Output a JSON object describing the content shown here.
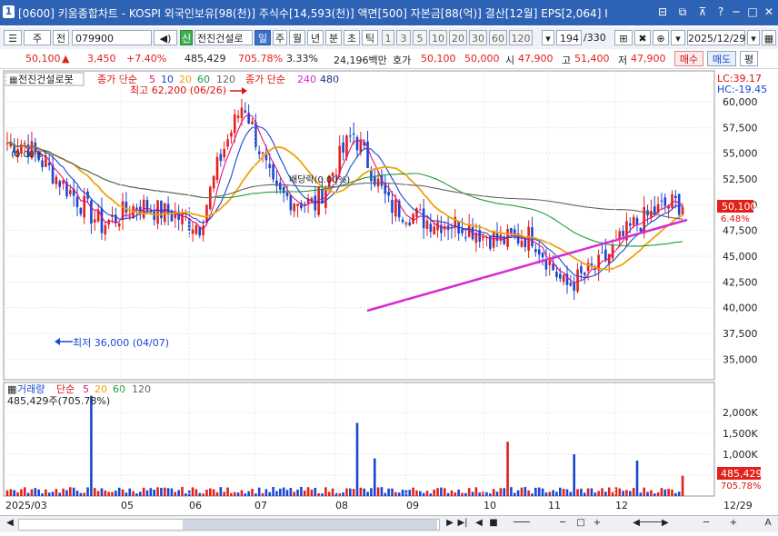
{
  "titlebar": {
    "window_number": "1",
    "title": "[0600] 키움종합차트 - KOSPI 외국인보유[98(천)] 주식수[14,593(천)] 액면[500] 자본금[88(억)] 결산[12월] EPS[2,064] I",
    "buttons": [
      "⊟",
      "⧉",
      "⊼",
      "?",
      "─",
      "□",
      "✕"
    ]
  },
  "toolbar": {
    "market": "주",
    "period_type": "전",
    "code": "079900",
    "credit_badge": "신",
    "stock_name": "전진건설로",
    "timeframes": [
      "일",
      "주",
      "월",
      "년",
      "분",
      "초",
      "틱"
    ],
    "selected_timeframe": "일",
    "ticks": [
      "1",
      "3",
      "5",
      "10",
      "20",
      "30",
      "60",
      "120"
    ],
    "count": "194",
    "total": "/330",
    "date": "2025/12/29"
  },
  "infobar": {
    "price": "50,100",
    "arrow": "▲",
    "change": "3,450",
    "pct": "+7.40%",
    "volume": "485,429",
    "vol_ratio": "705.78%",
    "turnover": "3.33%",
    "amount": "24,196백만",
    "quote_label": "호가",
    "bid": "50,100",
    "ask": "50,000",
    "open_label": "시",
    "open": "47,900",
    "high_label": "고",
    "high": "51,400",
    "low_label": "저",
    "low": "47,900",
    "buy": "매수",
    "sell": "매도",
    "eval": "평"
  },
  "price_panel": {
    "name": "전진건설로봇",
    "ma_label": "종가 단순",
    "ma_periods": [
      "5",
      "10",
      "20",
      "60",
      "120"
    ],
    "ma_colors": [
      "#e0117f",
      "#1a46d2",
      "#f0a20a",
      "#1f9b3a",
      "#666666"
    ],
    "ma2_label": "종가 단순",
    "ma2_periods": [
      "240",
      "480"
    ],
    "high_label": "최고 62,200 (06/26)",
    "low_label": "최저 36,000 (04/07)",
    "marker1": "(0.00%)",
    "marker2": "배당락(0.00%)",
    "lc": "LC:39.17",
    "hc": "HC:-19.45",
    "last_price": "50,100",
    "last_pct": "6.48%"
  },
  "volume_panel": {
    "label": "거래량",
    "ma_label": "단순",
    "ma_periods": [
      "5",
      "20",
      "60",
      "120"
    ],
    "value_label": "485,429주(705.78%)",
    "last_volume": "485,429",
    "last_pct": "705.78%"
  },
  "axes": {
    "price_ticks": [
      "60,000",
      "57,500",
      "55,000",
      "52,500",
      "50,000",
      "47,500",
      "45,000",
      "42,500",
      "40,000",
      "37,500",
      "35,000"
    ],
    "volume_ticks": [
      "2,000K",
      "1,500K",
      "1,000K",
      "500K"
    ],
    "x_ticks": [
      "2025/03",
      "05",
      "06",
      "07",
      "08",
      "09",
      "10",
      "11",
      "12"
    ],
    "x_right": "12/29"
  },
  "chart_data": {
    "type": "candlestick",
    "price_ylim": [
      33000,
      63000
    ],
    "closes_by_month": {
      "2025/03": [
        56000,
        52000,
        48000
      ],
      "04": [
        38000,
        42000
      ],
      "05": [
        50000,
        49000
      ],
      "06": [
        48000,
        55000,
        60000
      ],
      "07": [
        51000,
        50000
      ],
      "08": [
        57000,
        50000
      ],
      "09": [
        48500,
        48000
      ],
      "10": [
        46500,
        47000
      ],
      "11": [
        42000,
        44000
      ],
      "12": [
        48000,
        50100
      ]
    },
    "volume_ylim": [
      0,
      2500
    ],
    "volume_unit": "K"
  },
  "scrollbar": {
    "buttons": [
      "▶",
      "▶|",
      "◀",
      "■",
      "▶▶",
      "─",
      "□",
      "+",
      "◀",
      "▶",
      "─",
      "+",
      "A"
    ]
  }
}
